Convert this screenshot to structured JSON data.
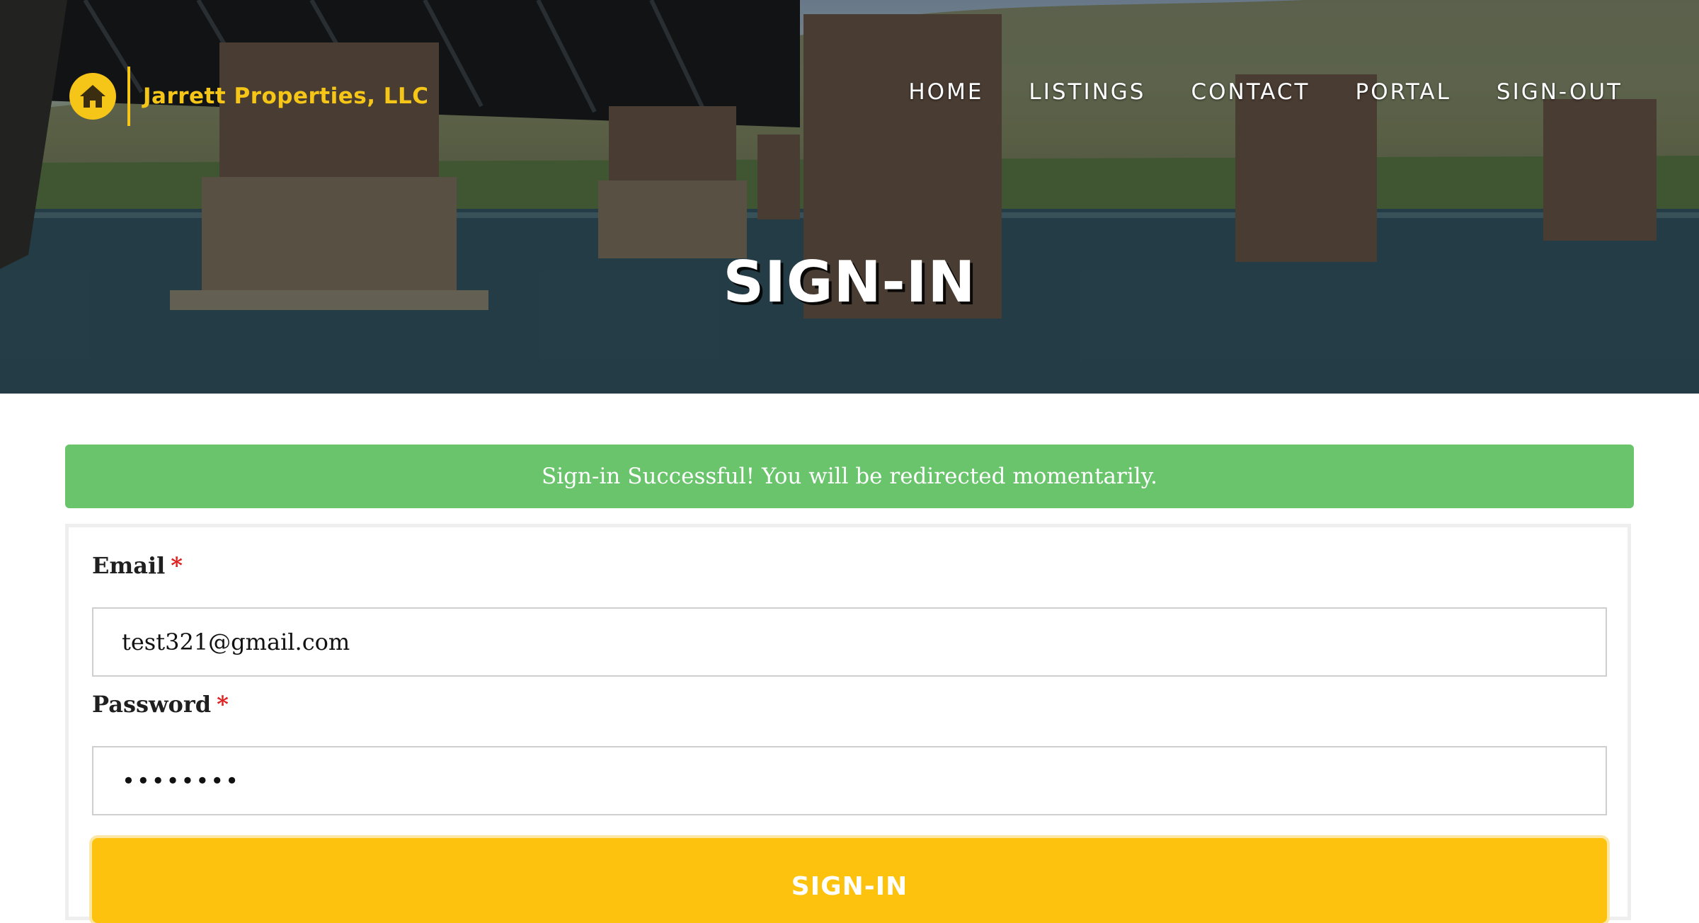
{
  "brand": {
    "name": "Jarrett Properties, LLC",
    "accent": "#f5c518"
  },
  "nav": {
    "items": [
      "HOME",
      "LISTINGS",
      "CONTACT",
      "PORTAL",
      "SIGN-OUT"
    ]
  },
  "hero": {
    "title": "SIGN-IN"
  },
  "alert": {
    "message": "Sign-in Successful! You will be redirected momentarily.",
    "color": "#69c46c"
  },
  "form": {
    "email_label": "Email",
    "email_value": "test321@gmail.com",
    "password_label": "Password",
    "password_value": "••••••••",
    "required_mark": "*",
    "submit_label": "SIGN-IN",
    "submit_color": "#fcc20d"
  }
}
